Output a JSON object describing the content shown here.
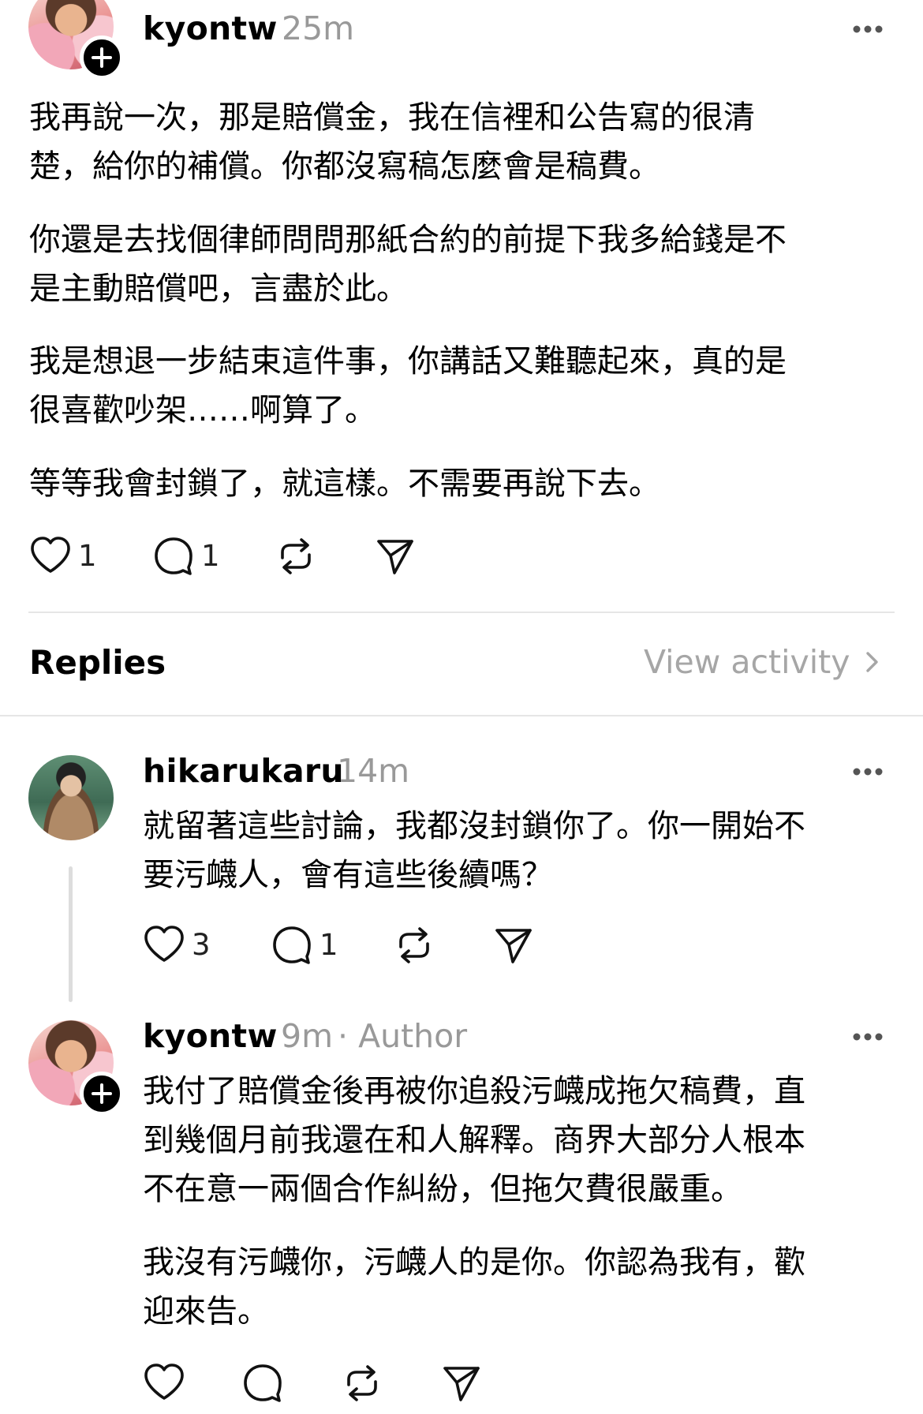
{
  "post": {
    "username": "kyontw",
    "time": "25m",
    "paragraphs": [
      [
        "我再說一次，那是賠償金，我在信裡和公告寫的很清",
        "楚，給你的補償。你都沒寫稿怎麼會是稿費。"
      ],
      [
        "你還是去找個律師問問那紙合約的前提下我多給錢是不",
        "是主動賠償吧，言盡於此。"
      ],
      [
        "我是想退一步結束這件事，你講話又難聽起來，真的是",
        "很喜歡吵架……啊算了。"
      ],
      [
        "等等我會封鎖了，就這樣。不需要再說下去。"
      ]
    ],
    "likes": "1",
    "comments": "1"
  },
  "replies_header": {
    "title": "Replies",
    "view_activity": "View activity"
  },
  "replies": [
    {
      "username": "hikarukaru",
      "time": "14m",
      "paragraphs": [
        [
          "就留著這些討論，我都沒封鎖你了。你一開始不",
          "要污衊人，會有這些後續嗎？"
        ]
      ],
      "likes": "3",
      "comments": "1"
    },
    {
      "username": "kyontw",
      "time": "9m",
      "author_tag": "· Author",
      "paragraphs": [
        [
          "我付了賠償金後再被你追殺污衊成拖欠稿費，直",
          "到幾個月前我還在和人解釋。商界大部分人根本",
          "不在意一兩個合作糾紛，但拖欠費很嚴重。"
        ],
        [
          "我沒有污衊你，污衊人的是你。你認為我有，歡",
          "迎來告。"
        ]
      ],
      "likes": "",
      "comments": ""
    }
  ],
  "icons": {
    "like": "heart-icon",
    "comment": "comment-icon",
    "repost": "repost-icon",
    "share": "send-icon",
    "more": "more-icon",
    "follow": "plus-icon",
    "chevron": "chevron-right-icon"
  },
  "colors": {
    "text": "#000000",
    "secondary": "#999999",
    "divider": "#e6e6e6",
    "thread_line": "#dddddd"
  }
}
